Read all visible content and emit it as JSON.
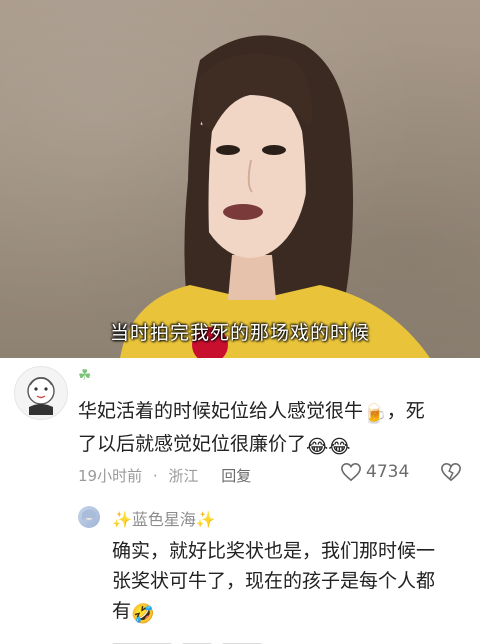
{
  "video": {
    "subtitle": "当时拍完我死的那场戏的时候"
  },
  "comments": [
    {
      "badge_icon": "clover-icon",
      "text_line1": "华妃活着的时候妃位给人感觉很牛",
      "emoji_beer": "🍺",
      "text_line1_tail": "，死",
      "text_line2": "了以后就感觉妃位很廉价了",
      "emoji_laugh": "😂😂",
      "time": "19小时前",
      "separator": "·",
      "location": "浙江",
      "reply_label": "回复",
      "like_count": "4734"
    },
    {
      "username": "✨蓝色星海✨",
      "text_line1": "确实，就好比奖状也是，我们那时候一",
      "text_line2": "张奖状可牛了，现在的孩子是每个人都",
      "text_line3": "有",
      "emoji_rofl": "🤣"
    }
  ],
  "colors": {
    "accent_yellow": "#e9c43a",
    "meta_gray": "#9a9a9a",
    "text": "#222222"
  }
}
